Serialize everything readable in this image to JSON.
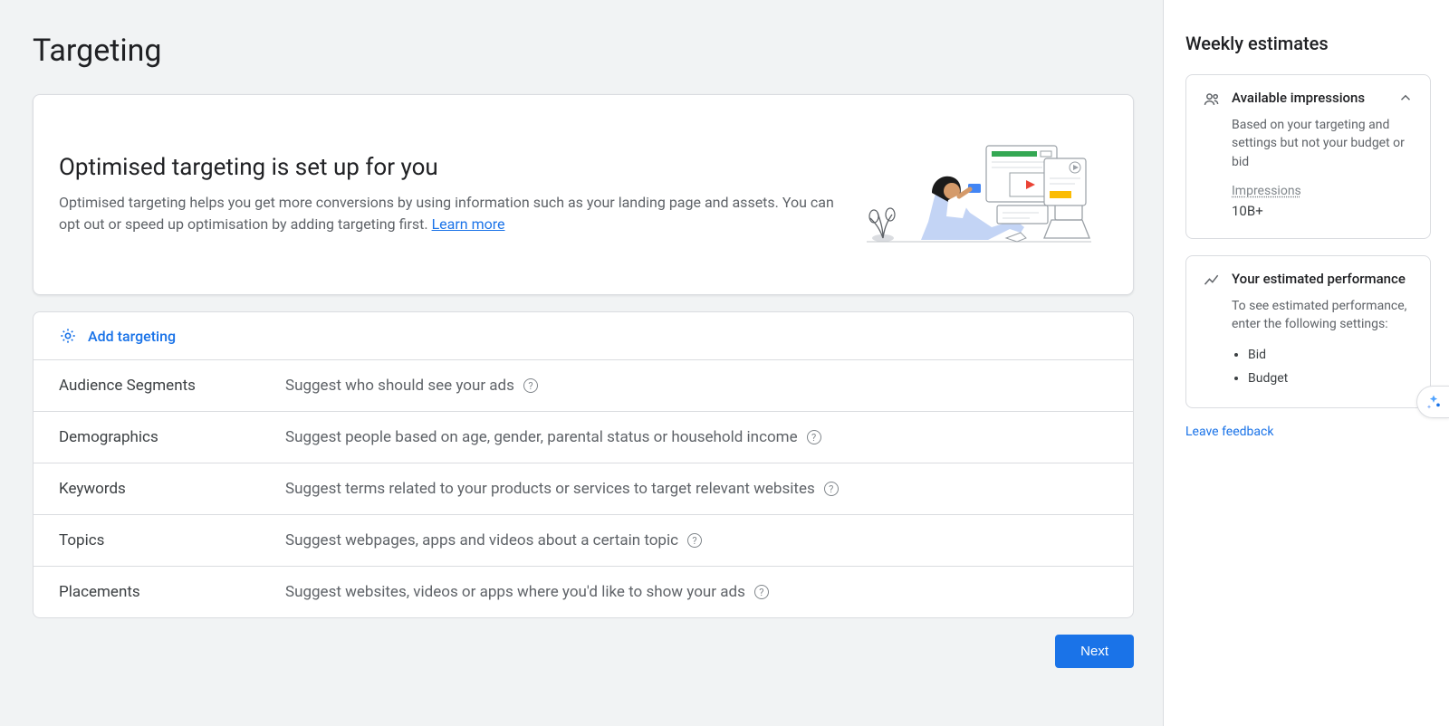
{
  "page": {
    "title": "Targeting"
  },
  "hero": {
    "title": "Optimised targeting is set up for you",
    "desc_part1": "Optimised targeting helps you get more conversions by using information such as your landing page and assets. You can opt out or speed up optimisation by adding targeting first. ",
    "learn_more": "Learn more"
  },
  "add_targeting": {
    "label": "Add targeting"
  },
  "rows": [
    {
      "label": "Audience Segments",
      "desc": "Suggest who should see your ads"
    },
    {
      "label": "Demographics",
      "desc": "Suggest people based on age, gender, parental status or household income"
    },
    {
      "label": "Keywords",
      "desc": "Suggest terms related to your products or services to target relevant websites"
    },
    {
      "label": "Topics",
      "desc": "Suggest webpages, apps and videos about a certain topic"
    },
    {
      "label": "Placements",
      "desc": "Suggest websites, videos or apps where you'd like to show your ads"
    }
  ],
  "footer": {
    "next": "Next"
  },
  "sidebar": {
    "title": "Weekly estimates",
    "impressions": {
      "title": "Available impressions",
      "desc": "Based on your targeting and settings but not your budget or bid",
      "label": "Impressions",
      "value": "10B+"
    },
    "performance": {
      "title": "Your estimated performance",
      "desc": "To see estimated performance, enter the following settings:",
      "items": [
        "Bid",
        "Budget"
      ]
    },
    "feedback": "Leave feedback"
  }
}
